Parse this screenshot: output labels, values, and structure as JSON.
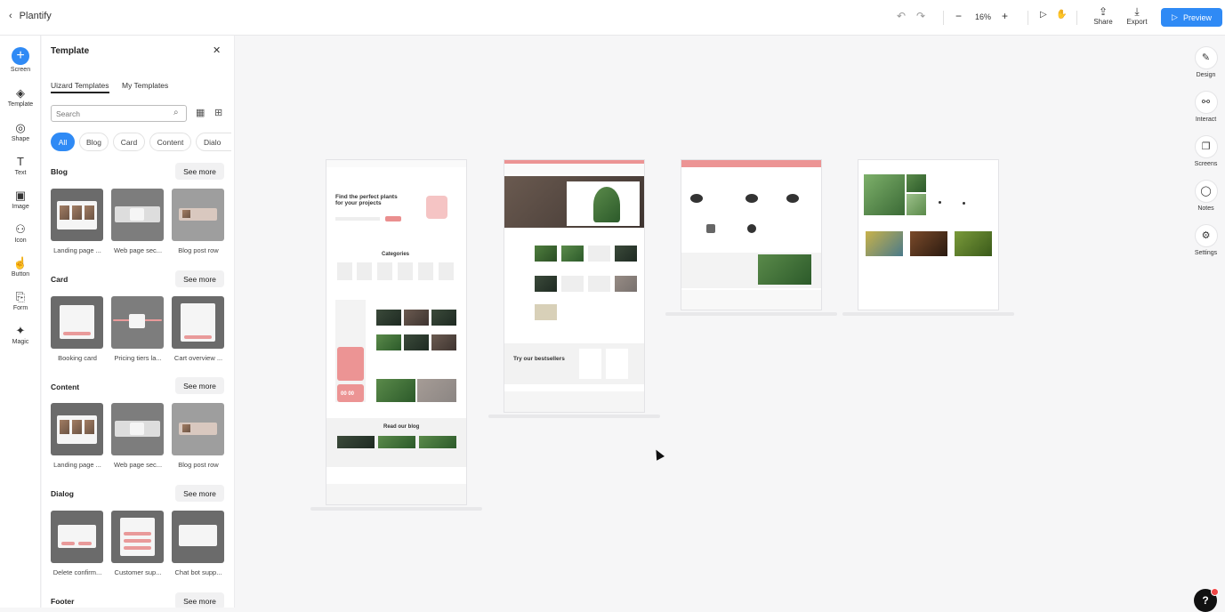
{
  "topbar": {
    "back_label": "Plantify",
    "zoom": "16%",
    "share_label": "Share",
    "export_label": "Export",
    "preview_label": "Preview"
  },
  "leftbar": {
    "items": [
      {
        "label": "Screen",
        "icon": "plus-icon"
      },
      {
        "label": "Template",
        "icon": "layers-icon"
      },
      {
        "label": "Shape",
        "icon": "shapes-icon"
      },
      {
        "label": "Text",
        "icon": "text-icon"
      },
      {
        "label": "Image",
        "icon": "image-icon"
      },
      {
        "label": "Icon",
        "icon": "icon-icon"
      },
      {
        "label": "Button",
        "icon": "button-icon"
      },
      {
        "label": "Form",
        "icon": "form-icon"
      },
      {
        "label": "Magic",
        "icon": "magic-wand-icon"
      }
    ]
  },
  "panel": {
    "title": "Template",
    "tabs": [
      "Uizard Templates",
      "My Templates"
    ],
    "search_placeholder": "Search",
    "chips": [
      "All",
      "Blog",
      "Card",
      "Content",
      "Dialo"
    ],
    "see_more": "See more",
    "sections": [
      {
        "title": "Blog",
        "items": [
          "Landing page ...",
          "Web page sec...",
          "Blog post row"
        ]
      },
      {
        "title": "Card",
        "items": [
          "Booking card",
          "Pricing tiers la...",
          "Cart overview ..."
        ]
      },
      {
        "title": "Content",
        "items": [
          "Landing page ...",
          "Web page sec...",
          "Blog post row"
        ]
      },
      {
        "title": "Dialog",
        "items": [
          "Delete confirm...",
          "Customer sup...",
          "Chat bot supp..."
        ]
      },
      {
        "title": "Footer",
        "items": []
      }
    ]
  },
  "canvas": {
    "frame1": {
      "hero": "Find the perfect plants for your projects",
      "categories": "Categories",
      "blog": "Read our blog",
      "price": "00 00"
    },
    "frame2": {
      "bestsellers": "Try our bestsellers"
    }
  },
  "rightbar": {
    "items": [
      {
        "label": "Design",
        "icon": "pencil-icon"
      },
      {
        "label": "Interact",
        "icon": "link-icon"
      },
      {
        "label": "Screens",
        "icon": "screens-icon"
      },
      {
        "label": "Notes",
        "icon": "notes-icon"
      },
      {
        "label": "Settings",
        "icon": "gear-icon"
      }
    ]
  },
  "help_label": "?",
  "colors": {
    "accent": "#2f8af5",
    "brand_pink": "#ec9494"
  }
}
